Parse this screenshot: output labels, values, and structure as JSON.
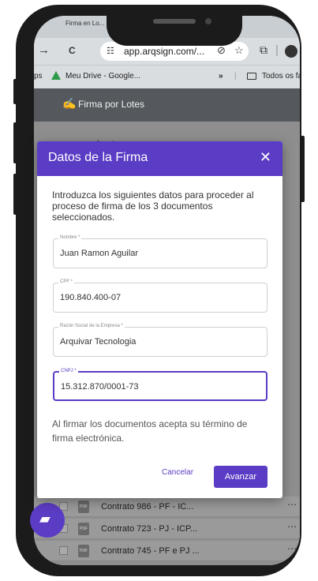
{
  "browser": {
    "tab_title": "Firma en Lo...",
    "back_glyph": "→",
    "reload_glyph": "C",
    "url": "app.arqsign.com/...",
    "bookmarks": [
      {
        "label": "ps"
      },
      {
        "label": "Meu Drive - Google..."
      },
      {
        "label": "»"
      },
      {
        "label": "Todos os fa"
      }
    ]
  },
  "app": {
    "header_title": "Firma por Lotes",
    "page_title": "rma por Lotes"
  },
  "documents": [
    {
      "name": "Contrato 986 - PF - IC..."
    },
    {
      "name": "Contrato 723 - PJ - ICP..."
    },
    {
      "name": "Contrato 745 - PF e PJ ..."
    }
  ],
  "modal": {
    "title": "Datos de la Firma",
    "close_glyph": "✕",
    "description": "Introduzca los siguientes datos para proceder al proceso de firma de los 3 documentos seleccionados.",
    "fields": [
      {
        "label": "Nombre *",
        "value": "Juan Ramon Aguilar"
      },
      {
        "label": "CPF *",
        "value": "190.840.400-07"
      },
      {
        "label": "Razón Social de la Empresa *",
        "value": "Arquivar Tecnologia"
      },
      {
        "label": "CNPJ *",
        "value": "15.312.870/0001-73"
      }
    ],
    "terms": "Al firmar los documentos acepta su término de firma electrónica.",
    "cancel_label": "Cancelar",
    "next_label": "Avanzar"
  },
  "colors": {
    "accent": "#5b3cc4",
    "overlay": "#8e8e8e"
  }
}
